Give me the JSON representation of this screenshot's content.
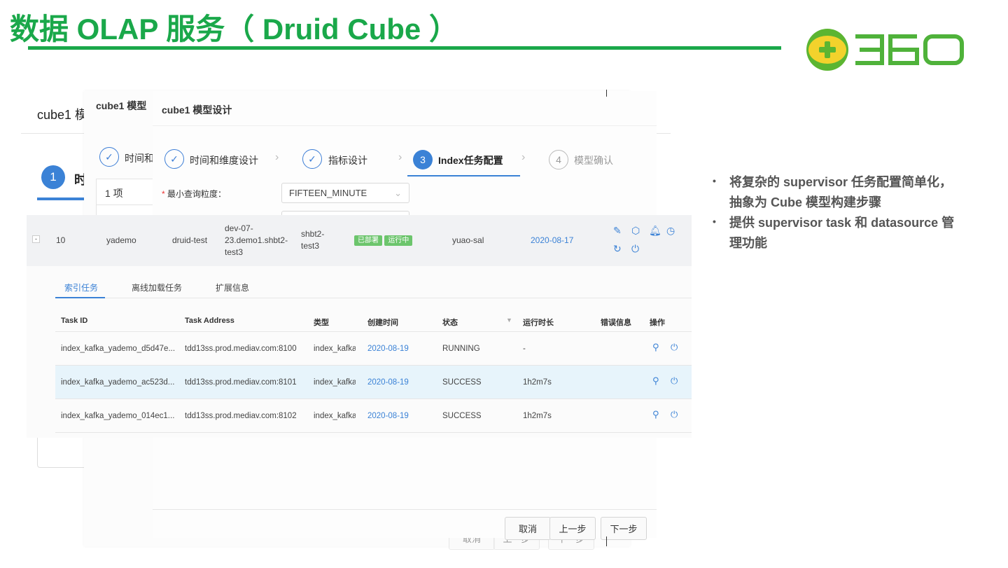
{
  "slide": {
    "title": "数据 OLAP 服务（ Druid Cube ）",
    "logo_text": "360",
    "bullets": [
      "将复杂的 supervisor 任务配置简单化，抽象为 Cube 模型构建步骤",
      "提供 supervisor task 和 datasource 管理功能"
    ]
  },
  "back_panel": {
    "title": "cube1 模",
    "step1_num": "1",
    "step1_label": "时"
  },
  "mid_panel": {
    "title": "cube1 模型",
    "step1_label": "时间和",
    "count": "1 项"
  },
  "modal": {
    "title": "cube1 模型设计",
    "steps": [
      {
        "label": "时间和维度设计",
        "state": "done"
      },
      {
        "label": "指标设计",
        "state": "done"
      },
      {
        "num": "3",
        "label": "Index任务配置",
        "state": "active"
      },
      {
        "num": "4",
        "label": "模型确认",
        "state": "pending"
      }
    ],
    "field_label": "最小查询粒度：",
    "required_mark": "*",
    "field_value": "FIFTEEN_MINUTE",
    "buttons": {
      "cancel": "取消",
      "prev": "上一步",
      "next": "下一步"
    }
  },
  "cube_row": {
    "expand": "-",
    "id": "10",
    "name": "yademo",
    "cluster": "druid-test",
    "host": "dev-07-23.demo1.shbt2-test3",
    "group": "shbt2-test3",
    "badges": [
      "已部署",
      "运行中"
    ],
    "owner": "yuao-sal",
    "date": "2020-08-17"
  },
  "detail_tabs": [
    "索引任务",
    "离线加载任务",
    "扩展信息"
  ],
  "task_table": {
    "headers": [
      "Task ID",
      "Task Address",
      "类型",
      "创建时间",
      "状态",
      "运行时长",
      "错误信息",
      "操作"
    ],
    "rows": [
      {
        "id": "index_kafka_yademo_d5d47e...",
        "address": "tdd13ss.prod.mediav.com:8100",
        "type": "index_kafka",
        "created": "2020-08-19",
        "status": "RUNNING",
        "duration": "-"
      },
      {
        "id": "index_kafka_yademo_ac523d...",
        "address": "tdd13ss.prod.mediav.com:8101",
        "type": "index_kafka",
        "created": "2020-08-19",
        "status": "SUCCESS",
        "duration": "1h2m7s"
      },
      {
        "id": "index_kafka_yademo_014ec1...",
        "address": "tdd13ss.prod.mediav.com:8102",
        "type": "index_kafka",
        "created": "2020-08-19",
        "status": "SUCCESS",
        "duration": "1h2m7s"
      }
    ]
  },
  "colors": {
    "brand": "#1aa84a",
    "accent": "#3b82d6",
    "badge": "#6cc56c"
  }
}
